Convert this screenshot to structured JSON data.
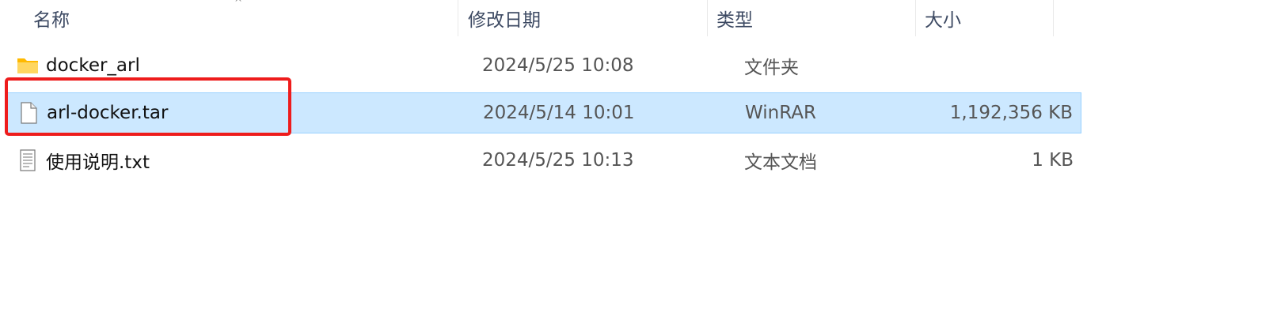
{
  "columns": {
    "name": "名称",
    "date": "修改日期",
    "type": "类型",
    "size": "大小"
  },
  "files": [
    {
      "name": "docker_arl",
      "date": "2024/5/25 10:08",
      "type": "文件夹",
      "size": "",
      "icon": "folder-icon",
      "selected": false
    },
    {
      "name": "arl-docker.tar",
      "date": "2024/5/14 10:01",
      "type": "WinRAR",
      "size": "1,192,356 KB",
      "icon": "file-icon",
      "selected": true
    },
    {
      "name": "使用说明.txt",
      "date": "2024/5/25 10:13",
      "type": "文本文档",
      "size": "1 KB",
      "icon": "text-file-icon",
      "selected": false
    }
  ],
  "colors": {
    "selection_bg": "#cce8ff",
    "selection_border": "#99d1ff",
    "highlight": "#ee1c1c",
    "header_text": "#3d4a63",
    "folder": "#ffc83d"
  }
}
